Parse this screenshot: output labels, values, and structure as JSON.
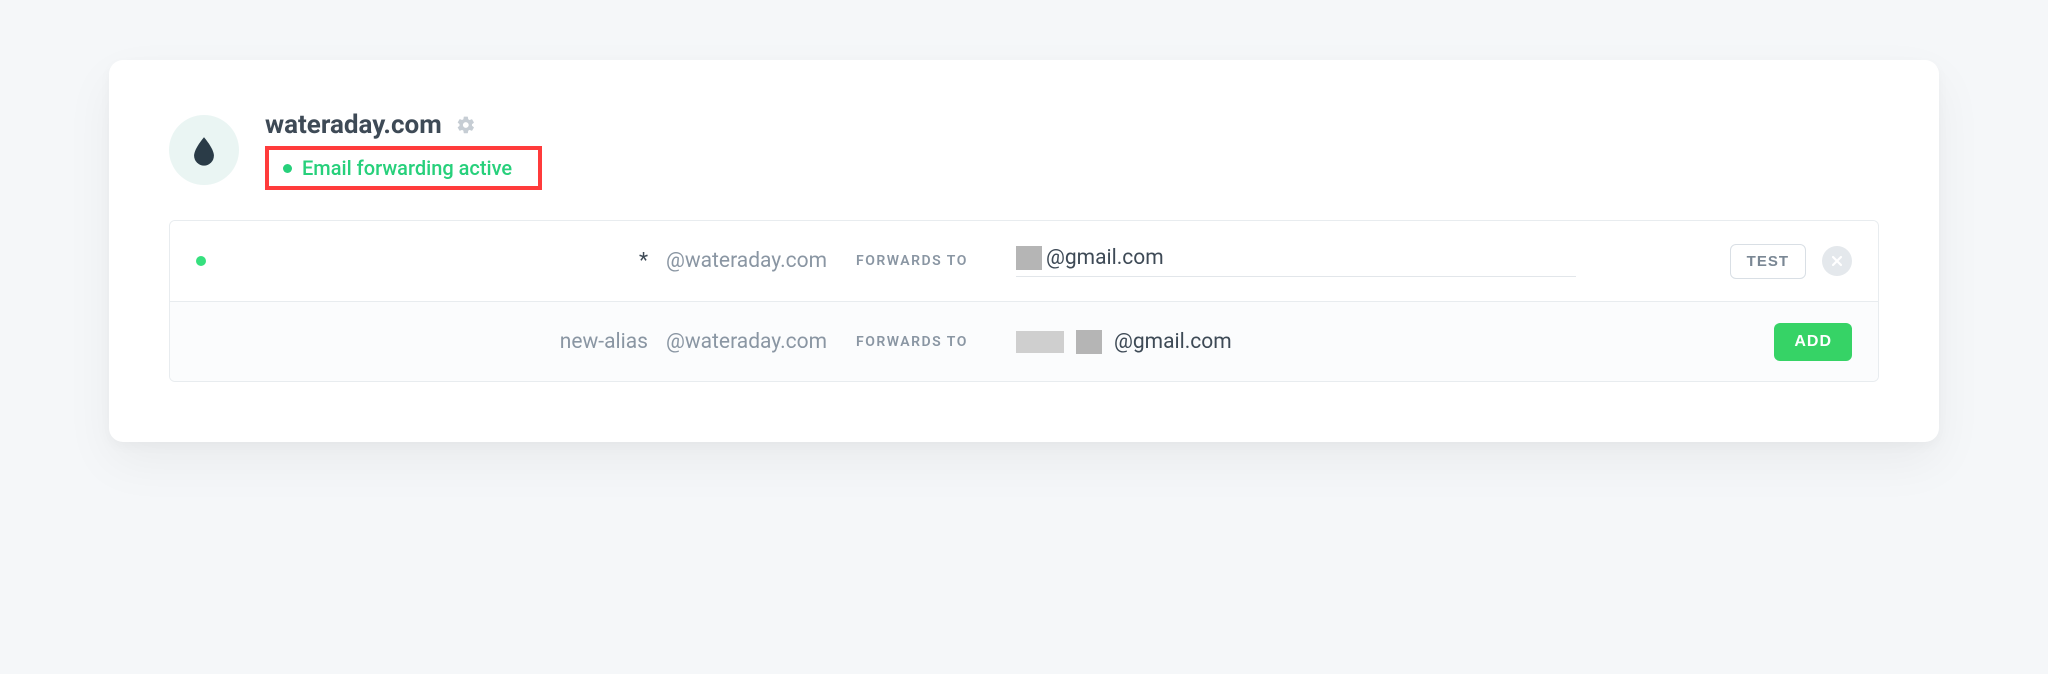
{
  "domain": {
    "name": "wateraday.com",
    "status_text": "Email forwarding active"
  },
  "labels": {
    "forwards_to": "FORWARDS TO",
    "test": "TEST",
    "add": "ADD"
  },
  "rows": [
    {
      "alias": "*",
      "domain_suffix": "@wateraday.com",
      "destination_suffix": "@gmail.com"
    }
  ],
  "new_row": {
    "alias_placeholder": "new-alias",
    "domain_suffix": "@wateraday.com",
    "destination_suffix": "@gmail.com"
  }
}
